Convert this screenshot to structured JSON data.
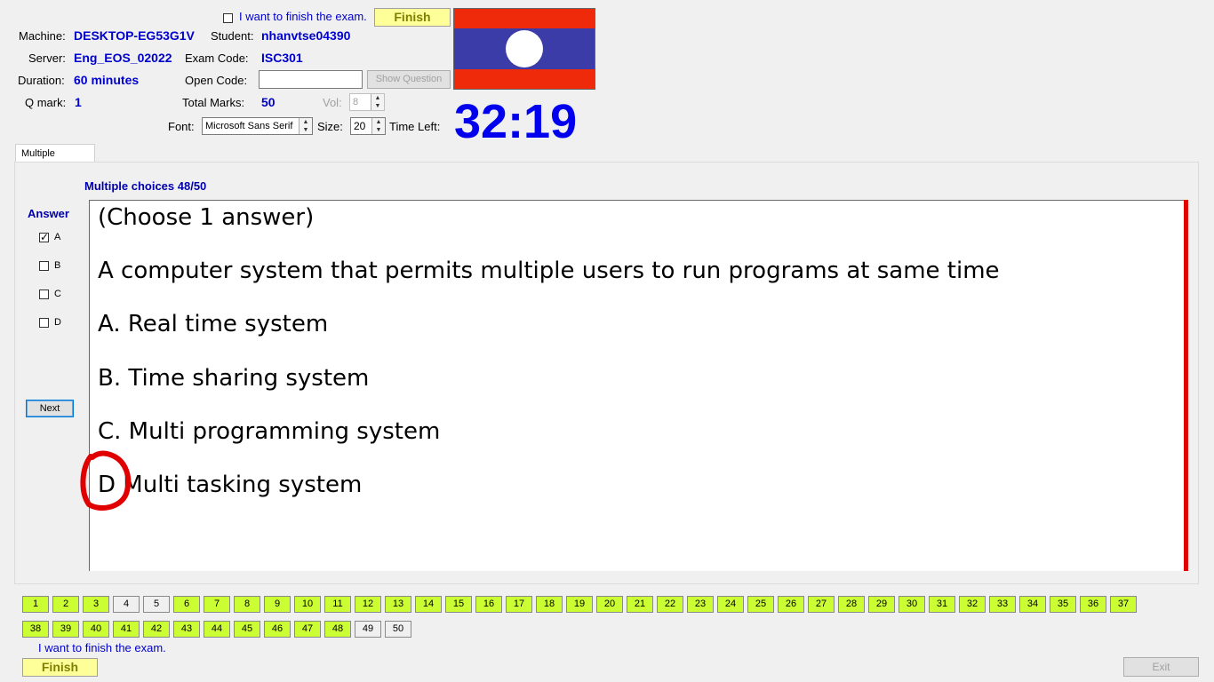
{
  "header": {
    "finish_check_label": "I want to finish the exam.",
    "finish_button": "Finish",
    "machine_label": "Machine:",
    "machine_value": "DESKTOP-EG53G1V",
    "student_label": "Student:",
    "student_value": "nhanvtse04390",
    "server_label": "Server:",
    "server_value": "Eng_EOS_02022",
    "exam_code_label": "Exam Code:",
    "exam_code_value": "ISC301",
    "duration_label": "Duration:",
    "duration_value": "60 minutes",
    "open_code_label": "Open Code:",
    "open_code_value": "",
    "show_question_button": "Show Question",
    "qmark_label": "Q mark:",
    "qmark_value": "1",
    "total_marks_label": "Total Marks:",
    "total_marks_value": "50",
    "vol_label": "Vol:",
    "vol_value": "8",
    "font_label": "Font:",
    "font_value": "Microsoft Sans Serif",
    "size_label": "Size:",
    "size_value": "20",
    "time_left_label": "Time Left:",
    "time_left_value": "32:19"
  },
  "flag": {
    "top_color": "#ee2a0a",
    "mid_color": "#3c3ca8",
    "circle_color": "#ffffff"
  },
  "tabs": [
    {
      "label": "Multiple Choices"
    }
  ],
  "main": {
    "progress_label": "Multiple choices 48/50",
    "answer_heading": "Answer",
    "answers": [
      {
        "label": "A",
        "checked": true
      },
      {
        "label": "B",
        "checked": false
      },
      {
        "label": "C",
        "checked": false
      },
      {
        "label": "D",
        "checked": false
      }
    ],
    "next_button": "Next",
    "question_lines": [
      "(Choose 1 answer)",
      "A computer system that permits multiple users to run programs at same time",
      "A.  Real time system",
      "B.  Time sharing system",
      "C.  Multi programming system",
      "D  Multi tasking system"
    ]
  },
  "questions": {
    "row1": [
      "1",
      "2",
      "3",
      "4",
      "5",
      "6",
      "7",
      "8",
      "9",
      "10",
      "11",
      "12",
      "13",
      "14",
      "15",
      "16",
      "17",
      "18",
      "19",
      "20",
      "21",
      "22",
      "23",
      "24",
      "25",
      "26",
      "27",
      "28",
      "29",
      "30",
      "31",
      "32",
      "33",
      "34",
      "35",
      "36",
      "37"
    ],
    "row2": [
      "38",
      "39",
      "40",
      "41",
      "42",
      "43",
      "44",
      "45",
      "46",
      "47",
      "48",
      "49",
      "50"
    ],
    "unanswered": [
      "4",
      "5",
      "49",
      "50"
    ]
  },
  "footer": {
    "finish_check_label": "I want to finish the exam.",
    "finish_button": "Finish",
    "exit_button": "Exit"
  },
  "colors": {
    "answered": "#ccff33",
    "timer": "#0000ee",
    "accent_red": "#e00000"
  }
}
